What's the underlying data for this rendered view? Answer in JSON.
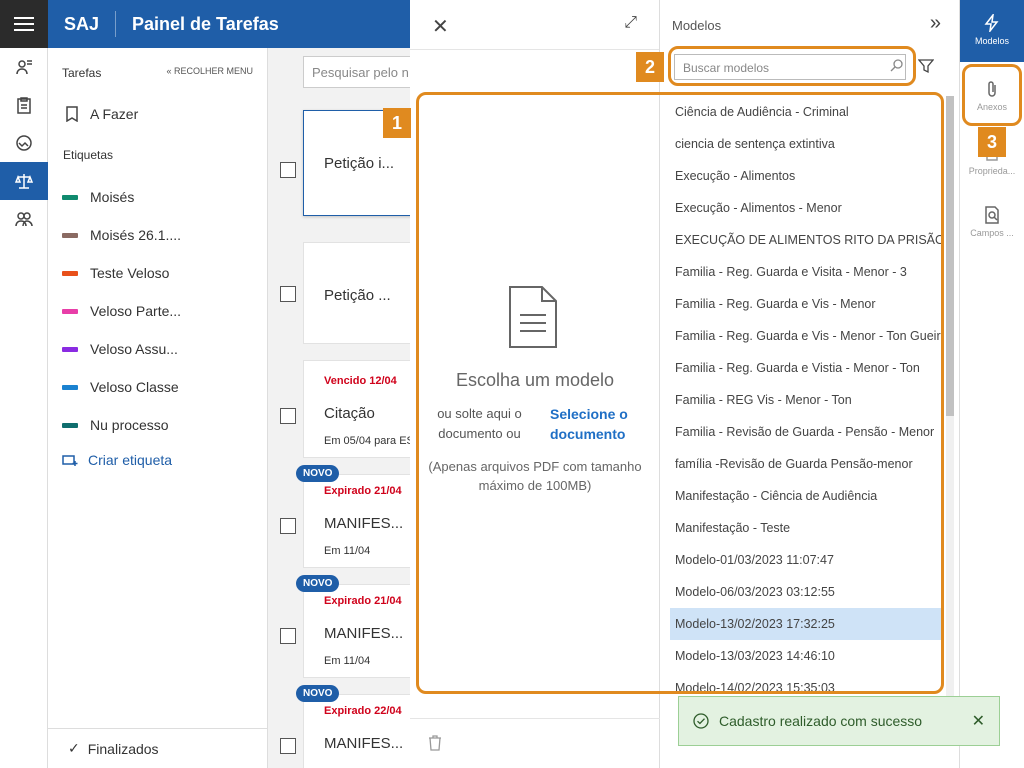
{
  "header": {
    "brand": "SAJ",
    "title": "Painel de Tarefas"
  },
  "sidebar": {
    "section": "Tarefas",
    "collapse_label": "RECOLHER MENU",
    "todo": "A Fazer",
    "tags_label": "Etiquetas",
    "tags": [
      {
        "label": "Moisés",
        "color": "#0f8a6e"
      },
      {
        "label": "Moisés 26.1....",
        "color": "#8a6a62"
      },
      {
        "label": "Teste Veloso",
        "color": "#e8501a"
      },
      {
        "label": "Veloso Parte...",
        "color": "#e83ea8"
      },
      {
        "label": "Veloso Assu...",
        "color": "#8a2be2"
      },
      {
        "label": "Veloso Classe",
        "color": "#1a82d0"
      },
      {
        "label": "Nu processo",
        "color": "#0f6e6e"
      }
    ],
    "create_tag": "Criar etiqueta",
    "finished": "Finalizados"
  },
  "list": {
    "search_placeholder": "Pesquisar pelo n",
    "cards": [
      {
        "title": "Petição i..."
      },
      {
        "title": "Petição ..."
      },
      {
        "due": "Vencido 12/04",
        "title": "Citação",
        "meta": "Em 05/04 para ES"
      },
      {
        "badge": "NOVO",
        "due": "Expirado 21/04",
        "title": "MANIFES...",
        "meta": "Em 11/04"
      },
      {
        "badge": "NOVO",
        "due": "Expirado 21/04",
        "title": "MANIFES...",
        "meta": "Em 11/04"
      },
      {
        "badge": "NOVO",
        "due": "Expirado 22/04",
        "title": "MANIFES..."
      }
    ]
  },
  "modal": {
    "choose_title": "Escolha um modelo",
    "drop_text": "ou solte aqui o documento ou",
    "select_link": "Selecione o documento",
    "hint": "(Apenas arquivos PDF com tamanho máximo de 100MB)"
  },
  "models": {
    "title": "Modelos",
    "search_placeholder": "Buscar modelos",
    "items": [
      "Ciência de Audiência - Criminal",
      "ciencia de sentença extintiva",
      "Execução - Alimentos",
      "Execução - Alimentos - Menor",
      "EXECUÇÃO DE ALIMENTOS RITO DA PRISÃO",
      "Familia - Reg. Guarda e Visita - Menor - 3",
      "Familia - Reg. Guarda e Vis - Menor",
      "Familia - Reg. Guarda e Vis - Menor - Ton Gueiros",
      "Familia - Reg. Guarda e Vistia - Menor - Ton",
      "Familia - REG Vis - Menor - Ton",
      "Familia - Revisão de Guarda - Pensão - Menor",
      "família -Revisão de Guarda Pensão-menor",
      "Manifestação - Ciência de Audiência",
      "Manifestação - Teste",
      "Modelo-01/03/2023 11:07:47",
      "Modelo-06/03/2023 03:12:55",
      "Modelo-13/02/2023 17:32:25",
      "Modelo-13/03/2023 14:46:10",
      "Modelo-14/02/2023 15:35:03"
    ],
    "selected_index": 16
  },
  "right_rail": {
    "models": "Modelos",
    "attachments": "Anexos",
    "properties": "Proprieda...",
    "fields": "Campos ..."
  },
  "callouts": [
    "1",
    "2",
    "3"
  ],
  "toast": {
    "message": "Cadastro realizado com sucesso"
  },
  "colors": {
    "primary": "#1f5ea8",
    "accent": "#e08a1f",
    "success_bg": "#e3f2e1"
  }
}
